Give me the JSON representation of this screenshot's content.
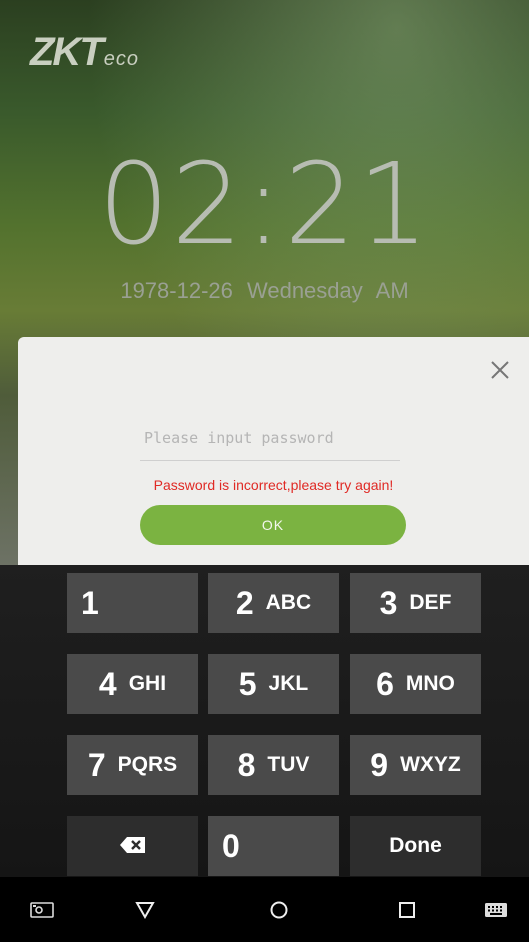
{
  "brand": {
    "logo_main": "ZKT",
    "logo_sub": "eco"
  },
  "clock": {
    "time": "02:21",
    "date": "1978-12-26  Wednesday  AM"
  },
  "dialog": {
    "password_placeholder": "Please input password",
    "password_value": "",
    "error_message": "Password is incorrect,please try again!",
    "ok_label": "OK",
    "accent_color": "#7bb341",
    "error_color": "#e02a25"
  },
  "keypad": {
    "keys": [
      {
        "num": "1",
        "letters": ""
      },
      {
        "num": "2",
        "letters": "ABC"
      },
      {
        "num": "3",
        "letters": "DEF"
      },
      {
        "num": "4",
        "letters": "GHI"
      },
      {
        "num": "5",
        "letters": "JKL"
      },
      {
        "num": "6",
        "letters": "MNO"
      },
      {
        "num": "7",
        "letters": "PQRS"
      },
      {
        "num": "8",
        "letters": "TUV"
      },
      {
        "num": "9",
        "letters": "WXYZ"
      },
      {
        "num": "0",
        "letters": ""
      }
    ],
    "backspace_icon": "backspace-icon",
    "done_label": "Done"
  },
  "navbar": {
    "icons": [
      "screenshot-icon",
      "back-triangle-icon",
      "home-circle-icon",
      "recents-square-icon",
      "keyboard-icon"
    ]
  }
}
